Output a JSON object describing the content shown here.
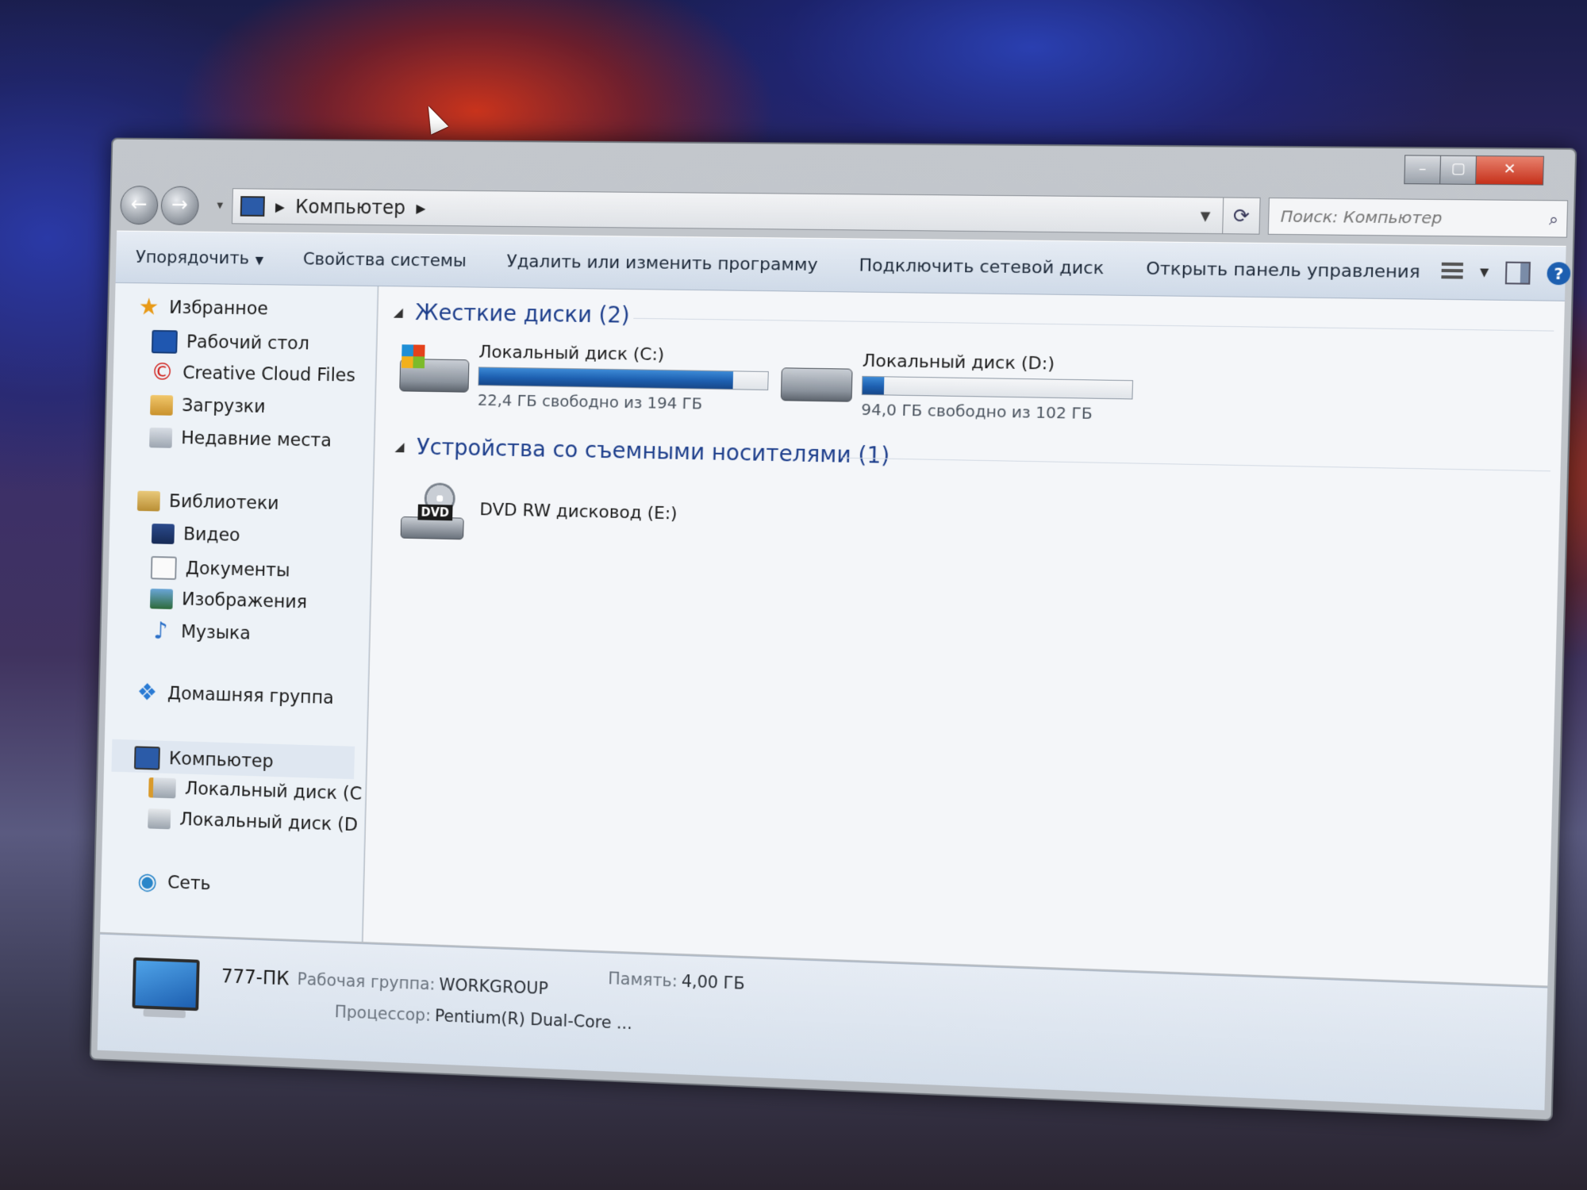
{
  "window": {
    "breadcrumb": "Компьютер",
    "search_placeholder": "Поиск: Компьютер",
    "controls": {
      "minimize": "–",
      "maximize": "▢",
      "close": "✕"
    }
  },
  "toolbar": {
    "organize": "Упорядочить",
    "system_properties": "Свойства системы",
    "uninstall": "Удалить или изменить программу",
    "map_drive": "Подключить сетевой диск",
    "control_panel": "Открыть панель управления"
  },
  "sidebar": {
    "favorites": "Избранное",
    "desktop": "Рабочий стол",
    "creative_cloud": "Creative Cloud Files",
    "downloads": "Загрузки",
    "recent": "Недавние места",
    "libraries": "Библиотеки",
    "video": "Видео",
    "documents": "Документы",
    "pictures": "Изображения",
    "music": "Музыка",
    "homegroup": "Домашняя группа",
    "computer": "Компьютер",
    "disk_c": "Локальный диск (C",
    "disk_d": "Локальный диск (D",
    "network": "Сеть"
  },
  "main": {
    "hard_drives_header": "Жесткие диски (2)",
    "removable_header": "Устройства со съемными носителями (1)",
    "drives": [
      {
        "name": "Локальный диск (C:)",
        "free_text": "22,4 ГБ свободно из 194 ГБ",
        "used_fraction": 0.88
      },
      {
        "name": "Локальный диск (D:)",
        "free_text": "94,0 ГБ свободно из 102 ГБ",
        "used_fraction": 0.08
      }
    ],
    "dvd": {
      "name": "DVD RW дисковод (E:)",
      "icon_label": "DVD"
    }
  },
  "details": {
    "pc_name": "777-ПК",
    "workgroup_label": "Рабочая группа:",
    "workgroup_value": "WORKGROUP",
    "memory_label": "Память:",
    "memory_value": "4,00 ГБ",
    "cpu_label": "Процессор:",
    "cpu_value": "Pentium(R) Dual-Core ..."
  },
  "icons": {
    "back": "arrow-left",
    "forward": "arrow-right",
    "refresh": "refresh",
    "search": "magnifier",
    "help": "?"
  }
}
